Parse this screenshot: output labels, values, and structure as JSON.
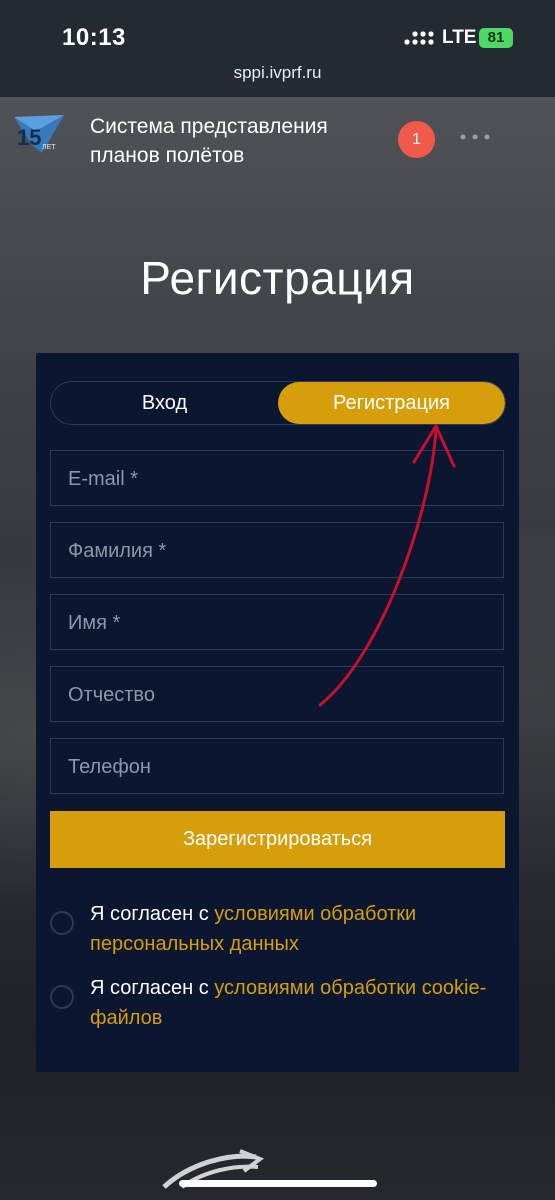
{
  "status_bar": {
    "time": "10:13",
    "network": "LTE",
    "battery": "81",
    "url": "sppi.ivprf.ru"
  },
  "header": {
    "logo_icon": "15-let-logo-icon",
    "title": "Система представления планов полётов",
    "notification_count": "1",
    "menu_icon": "more-dots-icon"
  },
  "page_title": "Регистрация",
  "tabs": {
    "login": "Вход",
    "register": "Регистрация",
    "active": "register"
  },
  "form": {
    "email_placeholder": "E-mail *",
    "lastname_placeholder": "Фамилия *",
    "firstname_placeholder": "Имя *",
    "middlename_placeholder": "Отчество",
    "phone_placeholder": "Телефон",
    "submit_label": "Зарегистрироваться"
  },
  "consents": [
    {
      "prefix": "Я согласен с ",
      "link": "условиями обработки персональных данных"
    },
    {
      "prefix": "Я согласен с ",
      "link": "условиями обработки cookie-файлов"
    }
  ],
  "colors": {
    "accent": "#d69e0a",
    "card": "#0b1631",
    "annotation_arrow": "#c8102e",
    "notification": "#f05a4a"
  }
}
